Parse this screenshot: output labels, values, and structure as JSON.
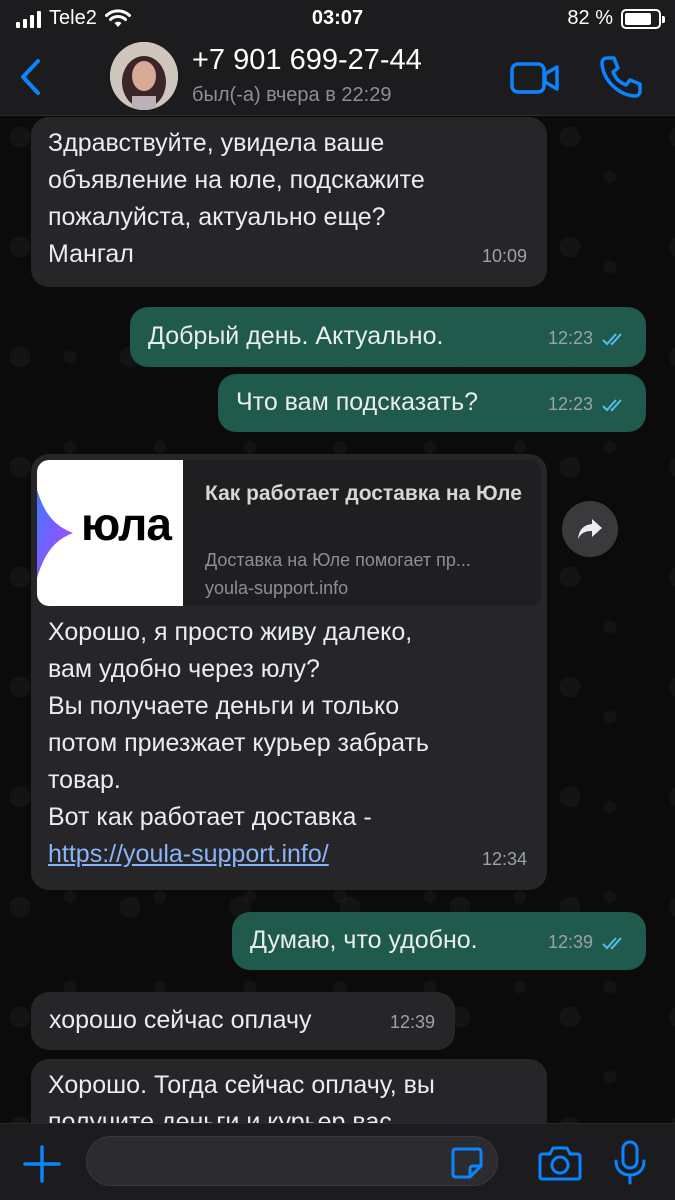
{
  "status_bar": {
    "carrier": "Tele2",
    "time": "03:07",
    "battery_percent_text": "82 %",
    "battery_level": 0.82,
    "icons": [
      "signal-icon",
      "wifi-icon",
      "battery-icon"
    ]
  },
  "header": {
    "contact_name": "+7 901 699-27-44",
    "last_seen": "был(-а) вчера в 22:29",
    "icons": [
      "back-chevron-icon",
      "video-call-icon",
      "phone-icon"
    ],
    "accent_color": "#0a84ff"
  },
  "messages": [
    {
      "direction": "in",
      "text": "Здравствуйте, увидела ваше\nобъявление на юле, подскажите\nпожалуйста, актуально еще?\nМангал",
      "time": "10:09"
    },
    {
      "direction": "out",
      "text": "Добрый день. Актуально.",
      "time": "12:23",
      "read": true
    },
    {
      "direction": "out",
      "text": "Что вам подсказать?",
      "time": "12:23",
      "read": true
    },
    {
      "direction": "in",
      "preview": {
        "logo_text": "юла",
        "title": "Как работает доставка на Юле",
        "description": "Доставка на Юле помогает пр...",
        "domain": "youla-support.info"
      },
      "text": "Хорошо, я просто живу далеко,\nвам удобно через юлу?\nВы получаете деньги и только\nпотом приезжает курьер забрать\nтовар.\nВот как работает доставка -",
      "link": "https://youla-support.info/",
      "time": "12:34"
    },
    {
      "direction": "out",
      "text": "Думаю, что удобно.",
      "time": "12:39",
      "read": true
    },
    {
      "direction": "in",
      "text": "хорошо сейчас оплачу",
      "time": "12:39"
    },
    {
      "direction": "in",
      "text": "Хорошо. Тогда сейчас оплачу, вы\nполучите деньги и курьер вас"
    }
  ],
  "input_bar": {
    "placeholder": "",
    "icons": [
      "plus-icon",
      "sticker-icon",
      "camera-icon",
      "microphone-icon"
    ]
  },
  "colors": {
    "incoming_bubble": "#262628",
    "outgoing_bubble": "#1f5a4d",
    "read_ticks": "#53bdeb",
    "link": "#8ab4f8"
  }
}
